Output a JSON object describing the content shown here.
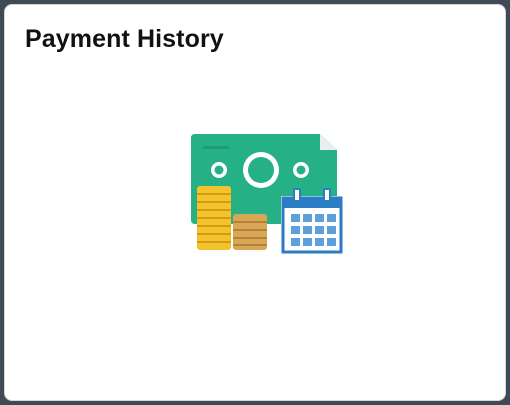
{
  "tile": {
    "title": "Payment History",
    "icon": "payment-history-icon"
  },
  "colors": {
    "banknote": "#25b185",
    "banknote_shadow": "#1c9d74",
    "banknote_fold": "#e9eef0",
    "coin_gold": "#f3c22c",
    "coin_gold_line": "#d29b12",
    "coin_bronze": "#d8a755",
    "coin_bronze_line": "#b6823a",
    "calendar_blue": "#2a7dc4",
    "calendar_cell": "#5ba0db",
    "frame": "#3f4a56"
  }
}
